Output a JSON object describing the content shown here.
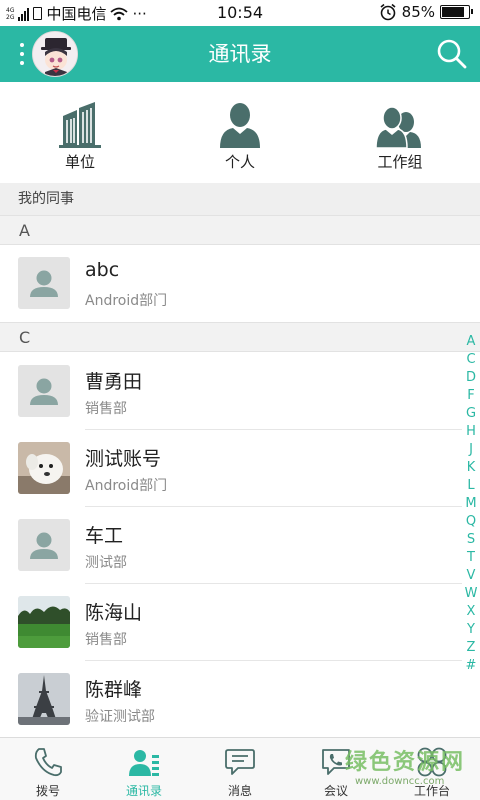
{
  "status_bar": {
    "net_top": "4G",
    "net_bottom": "2G",
    "carrier": "中国电信",
    "more": "···",
    "time": "10:54",
    "battery": "85%",
    "battery_level": 0.85
  },
  "header": {
    "title": "通讯录",
    "menu_icon": "more-vertical-icon",
    "search_icon": "search-icon"
  },
  "categories": [
    {
      "label": "单位",
      "icon": "building-icon"
    },
    {
      "label": "个人",
      "icon": "person-icon"
    },
    {
      "label": "工作组",
      "icon": "group-icon"
    }
  ],
  "section_title": "我的同事",
  "groups": [
    {
      "letter": "A",
      "contacts": [
        {
          "name": "abc",
          "dept": "Android部门",
          "photo": "default-avatar"
        }
      ]
    },
    {
      "letter": "C",
      "contacts": [
        {
          "name": "曹勇田",
          "dept": "销售部",
          "photo": "default-avatar"
        },
        {
          "name": "测试账号",
          "dept": "Android部门",
          "photo": "dog-photo"
        },
        {
          "name": "车工",
          "dept": "测试部",
          "photo": "default-avatar"
        },
        {
          "name": "陈海山",
          "dept": "销售部",
          "photo": "grass-field-photo"
        },
        {
          "name": "陈群峰",
          "dept": "验证测试部",
          "photo": "eiffel-tower-photo"
        }
      ]
    }
  ],
  "index_letters": [
    "A",
    "C",
    "D",
    "F",
    "G",
    "H",
    "J",
    "K",
    "L",
    "M",
    "Q",
    "S",
    "T",
    "V",
    "W",
    "X",
    "Y",
    "Z",
    "#"
  ],
  "tabs": [
    {
      "label": "拨号",
      "icon": "phone-icon",
      "active": false
    },
    {
      "label": "通讯录",
      "icon": "contacts-icon",
      "active": true
    },
    {
      "label": "消息",
      "icon": "message-icon",
      "active": false
    },
    {
      "label": "会议",
      "icon": "meeting-icon",
      "active": false
    },
    {
      "label": "工作台",
      "icon": "workbench-icon",
      "active": false
    }
  ],
  "watermark": {
    "line1": "绿色资源网",
    "line2": "www.downcc.com"
  },
  "colors": {
    "accent": "#2bb8a4",
    "icon_dark": "#4a6e6b",
    "avatar_grey": "#8aa5a2"
  }
}
